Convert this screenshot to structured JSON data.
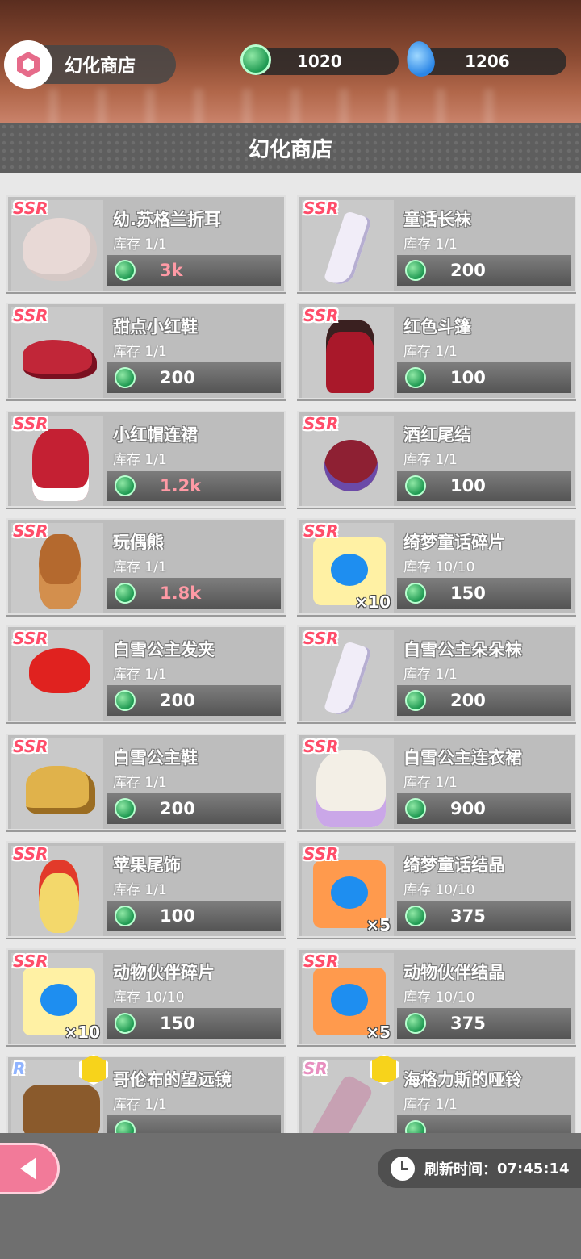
{
  "header": {
    "shop_label": "幻化商店",
    "green_currency": "1020",
    "blue_currency": "1206"
  },
  "title": "幻化商店",
  "items": [
    {
      "rarity": "SSR",
      "name": "幼.苏格兰折耳",
      "stock": "库存 1/1",
      "price": "3k",
      "price_highlight": true,
      "art": "cat"
    },
    {
      "rarity": "SSR",
      "name": "童话长袜",
      "stock": "库存 1/1",
      "price": "200",
      "price_highlight": false,
      "art": "sock"
    },
    {
      "rarity": "SSR",
      "name": "甜点小红鞋",
      "stock": "库存 1/1",
      "price": "200",
      "price_highlight": false,
      "art": "red-shoe"
    },
    {
      "rarity": "SSR",
      "name": "红色斗篷",
      "stock": "库存 1/1",
      "price": "100",
      "price_highlight": false,
      "art": "cape"
    },
    {
      "rarity": "SSR",
      "name": "小红帽连裙",
      "stock": "库存 1/1",
      "price": "1.2k",
      "price_highlight": true,
      "art": "dress"
    },
    {
      "rarity": "SSR",
      "name": "酒红尾结",
      "stock": "库存 1/1",
      "price": "100",
      "price_highlight": false,
      "art": "bow"
    },
    {
      "rarity": "SSR",
      "name": "玩偶熊",
      "stock": "库存 1/1",
      "price": "1.8k",
      "price_highlight": true,
      "art": "bear"
    },
    {
      "rarity": "SSR",
      "name": "绮梦童话碎片",
      "stock": "库存 10/10",
      "price": "150",
      "price_highlight": false,
      "art": "shirt-yellow",
      "multiplier": "×10"
    },
    {
      "rarity": "SSR",
      "name": "白雪公主发夹",
      "stock": "库存 1/1",
      "price": "200",
      "price_highlight": false,
      "art": "ribbon"
    },
    {
      "rarity": "SSR",
      "name": "白雪公主朵朵袜",
      "stock": "库存 1/1",
      "price": "200",
      "price_highlight": false,
      "art": "sock"
    },
    {
      "rarity": "SSR",
      "name": "白雪公主鞋",
      "stock": "库存 1/1",
      "price": "200",
      "price_highlight": false,
      "art": "heels"
    },
    {
      "rarity": "SSR",
      "name": "白雪公主连衣裙",
      "stock": "库存 1/1",
      "price": "900",
      "price_highlight": false,
      "art": "gown"
    },
    {
      "rarity": "SSR",
      "name": "苹果尾饰",
      "stock": "库存 1/1",
      "price": "100",
      "price_highlight": false,
      "art": "tail"
    },
    {
      "rarity": "SSR",
      "name": "绮梦童话结晶",
      "stock": "库存 10/10",
      "price": "375",
      "price_highlight": false,
      "art": "shirt-orange",
      "multiplier": "×5"
    },
    {
      "rarity": "SSR",
      "name": "动物伙伴碎片",
      "stock": "库存 10/10",
      "price": "150",
      "price_highlight": false,
      "art": "shirt-yellow",
      "multiplier": "×10"
    },
    {
      "rarity": "SSR",
      "name": "动物伙伴结晶",
      "stock": "库存 10/10",
      "price": "375",
      "price_highlight": false,
      "art": "shirt-orange",
      "multiplier": "×5"
    },
    {
      "rarity": "R",
      "name": "哥伦布的望远镜",
      "stock": "库存 1/1",
      "price": "",
      "price_highlight": false,
      "art": "scope",
      "medal": true
    },
    {
      "rarity": "SR",
      "name": "海格力斯的哑铃",
      "stock": "库存 1/1",
      "price": "",
      "price_highlight": false,
      "art": "dumbbell",
      "medal": true
    }
  ],
  "footer": {
    "refresh_label": "刷新时间：",
    "refresh_time": "07:45:14"
  },
  "colors": {
    "accent_pink": "#f27a99",
    "price_highlight": "#ff9aa5",
    "gem_green": "#1f9a52",
    "panel_gray": "#bdbdbd"
  }
}
